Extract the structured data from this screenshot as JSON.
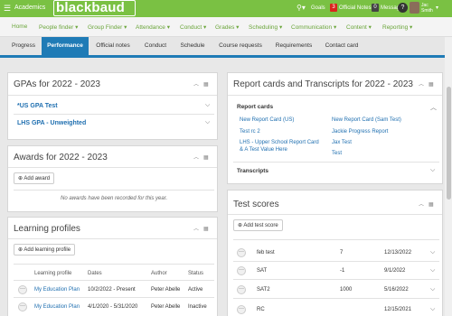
{
  "topbar": {
    "menu_icon": "hamburger-icon",
    "section": "Academics",
    "logo": "blackbaud",
    "search_icon": "search-icon",
    "goals": "Goals",
    "notes_count": "3",
    "notes_label": "Official Notes",
    "messages_count": "0",
    "messages_label": "Messages",
    "help": "?",
    "user_line1": "Jac",
    "user_line2": "Smith"
  },
  "nav": {
    "items": [
      {
        "label": "Home"
      },
      {
        "label": "People finder ▾"
      },
      {
        "label": "Group Finder ▾"
      },
      {
        "label": "Attendance ▾"
      },
      {
        "label": "Conduct ▾"
      },
      {
        "label": "Grades ▾"
      },
      {
        "label": "Scheduling ▾"
      },
      {
        "label": "Communication ▾"
      },
      {
        "label": "Content ▾"
      },
      {
        "label": "Reporting ▾"
      }
    ]
  },
  "tabs": {
    "items": [
      {
        "label": "Progress"
      },
      {
        "label": "Performance"
      },
      {
        "label": "Official notes"
      },
      {
        "label": "Conduct"
      },
      {
        "label": "Schedule"
      },
      {
        "label": "Course requests"
      },
      {
        "label": "Requirements"
      },
      {
        "label": "Contact card"
      }
    ],
    "active": "Performance"
  },
  "gpas": {
    "title": "GPAs for 2022 - 2023",
    "items": [
      {
        "label": "*US GPA Test"
      },
      {
        "label": "LHS GPA - Unweighted"
      }
    ]
  },
  "awards": {
    "title": "Awards for 2022 - 2023",
    "add_label": "Add award",
    "empty_text": "No awards have been recorded for this year."
  },
  "learning": {
    "title": "Learning profiles",
    "add_label": "Add learning profile",
    "columns": [
      "Learning profile",
      "Dates",
      "Author",
      "Status"
    ],
    "rows": [
      {
        "profile": "My Education Plan",
        "dates": "10/2/2022 - Present",
        "author": "Peter Abelle",
        "status": "Active"
      },
      {
        "profile": "My Education Plan",
        "dates": "4/1/2020 - 5/31/2020",
        "author": "Peter Abelle",
        "status": "Inactive"
      }
    ]
  },
  "reports": {
    "title": "Report cards and Transcripts for 2022 - 2023",
    "report_cards_label": "Report cards",
    "left_links": [
      "New Report Card (US)",
      "Test rc 2",
      "LHS - Upper School Report Card",
      "& A Test Value Here"
    ],
    "right_links": [
      "New Report Card (Sam Test)",
      "Jackie Progress Report",
      "Jax Test",
      "Test"
    ],
    "transcripts_label": "Transcripts"
  },
  "tests": {
    "title": "Test scores",
    "add_label": "Add test score",
    "rows": [
      {
        "name": "feb test",
        "score": "7",
        "date": "12/13/2022"
      },
      {
        "name": "SAT",
        "score": "-1",
        "date": "9/1/2022"
      },
      {
        "name": "SAT2",
        "score": "1000",
        "date": "5/16/2022"
      },
      {
        "name": "RC",
        "score": "",
        "date": "12/15/2021"
      }
    ]
  },
  "colors": {
    "brand_green": "#7ac143",
    "nav_green": "#6aa53a",
    "tab_blue": "#1f7bb6",
    "link_blue": "#1f6fb0"
  }
}
